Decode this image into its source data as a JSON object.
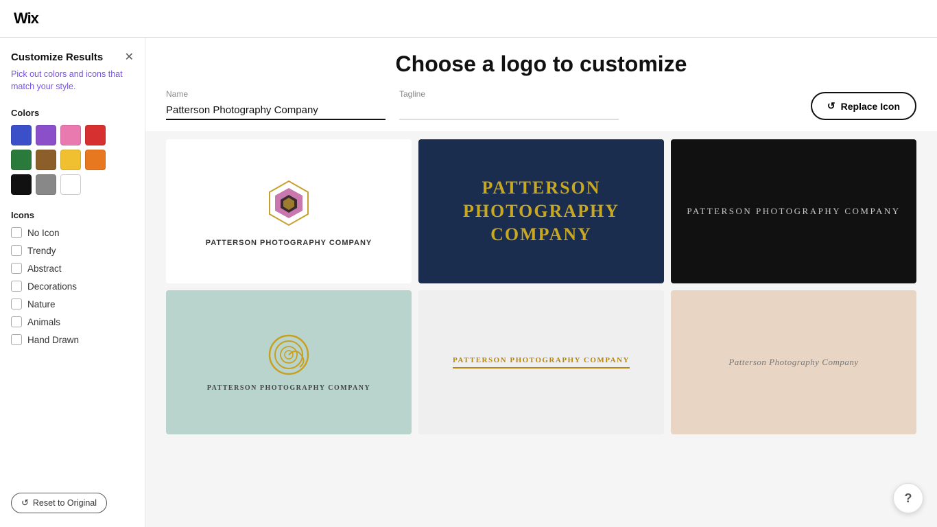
{
  "header": {
    "logo_text": "Wix"
  },
  "sidebar": {
    "title": "Customize Results",
    "subtitle": "Pick out colors and icons that match your style.",
    "colors_section_label": "Colors",
    "colors": [
      {
        "id": "blue",
        "hex": "#3b4fc9"
      },
      {
        "id": "purple",
        "hex": "#8b4fc9"
      },
      {
        "id": "pink",
        "hex": "#e87ab0"
      },
      {
        "id": "red",
        "hex": "#d63031"
      },
      {
        "id": "green",
        "hex": "#2a7a3b"
      },
      {
        "id": "brown",
        "hex": "#8b5e2a"
      },
      {
        "id": "yellow",
        "hex": "#f0c030"
      },
      {
        "id": "orange",
        "hex": "#e87820"
      },
      {
        "id": "black",
        "hex": "#111111"
      },
      {
        "id": "gray",
        "hex": "#888888"
      },
      {
        "id": "white",
        "hex": "#ffffff"
      }
    ],
    "icons_section_label": "Icons",
    "icon_options": [
      {
        "id": "no-icon",
        "label": "No Icon",
        "checked": false
      },
      {
        "id": "trendy",
        "label": "Trendy",
        "checked": false
      },
      {
        "id": "abstract",
        "label": "Abstract",
        "checked": false
      },
      {
        "id": "decorations",
        "label": "Decorations",
        "checked": false
      },
      {
        "id": "nature",
        "label": "Nature",
        "checked": false
      },
      {
        "id": "animals",
        "label": "Animals",
        "checked": false
      },
      {
        "id": "hand-drawn",
        "label": "Hand Drawn",
        "checked": false
      }
    ],
    "reset_button_label": "Reset to Original"
  },
  "main": {
    "page_title": "Choose a logo to customize",
    "name_label": "Name",
    "name_value": "Patterson Photography Company",
    "tagline_label": "Tagline",
    "tagline_value": "",
    "tagline_placeholder": "",
    "replace_icon_label": "Replace Icon",
    "logo_cards": [
      {
        "id": "card-1",
        "bg": "white",
        "company_name": "Patterson Photography Company",
        "style": "geometric-icon"
      },
      {
        "id": "card-2",
        "bg": "dark-blue",
        "company_name": "Patterson Photography Company",
        "style": "serif-large"
      },
      {
        "id": "card-3",
        "bg": "black",
        "company_name": "Patterson Photography Company",
        "style": "serif-small"
      },
      {
        "id": "card-4",
        "bg": "mint",
        "company_name": "Patterson Photography Company",
        "style": "spiral-icon"
      },
      {
        "id": "card-5",
        "bg": "light-gray",
        "company_name": "Patterson Photography Company",
        "style": "underline-text"
      },
      {
        "id": "card-6",
        "bg": "peach",
        "company_name": "Patterson Photography Company",
        "style": "italic-text"
      }
    ]
  },
  "help": {
    "label": "?"
  }
}
